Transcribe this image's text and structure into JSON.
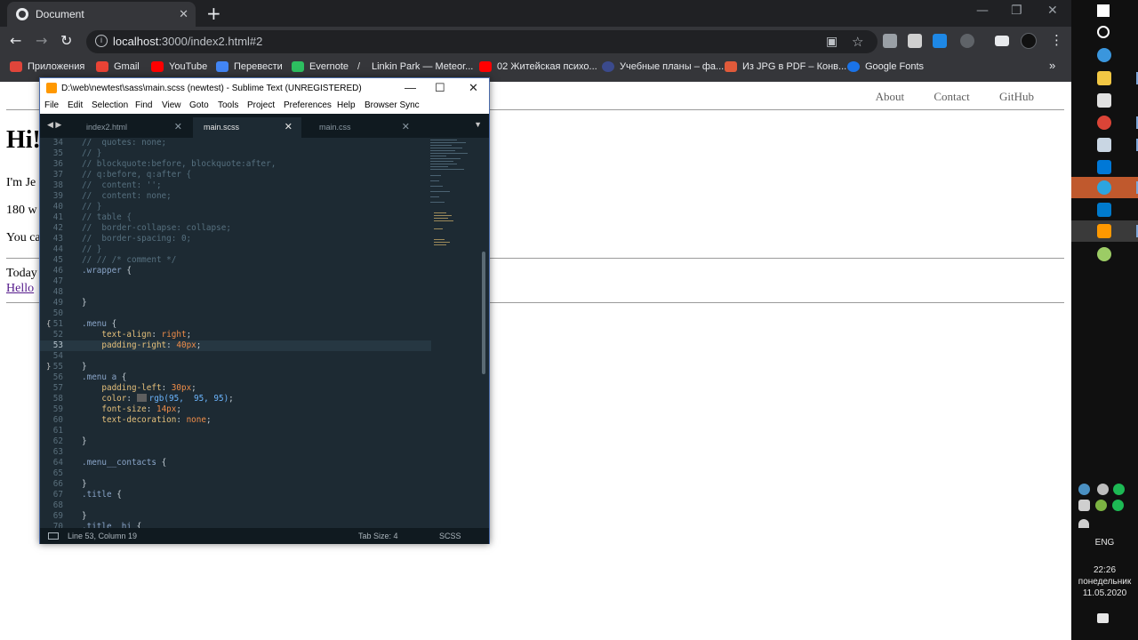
{
  "chrome": {
    "tab_title": "Document",
    "tab_close": "✕",
    "new_tab": "+",
    "window_controls": [
      "—",
      "❐",
      "✕"
    ],
    "url_host": "localhost",
    "url_rest": ":3000/index2.html#2",
    "icons": [
      "back-icon",
      "forward-icon",
      "reload-icon",
      "info-icon",
      "translate-icon",
      "star-icon",
      "menu-dots-icon"
    ],
    "bookmarks": [
      {
        "label": "Приложения",
        "color": "#e0453a"
      },
      {
        "label": "Gmail",
        "color": "#ea4335"
      },
      {
        "label": "YouTube",
        "color": "#ff0000"
      },
      {
        "label": "Перевести",
        "color": "#4285f4"
      },
      {
        "label": "Evernote",
        "color": "#2dbe60"
      },
      {
        "label": "Linkin Park — Meteor...",
        "color": "#dddddd"
      },
      {
        "label": "02 Житейская психо...",
        "color": "#ff0000"
      },
      {
        "label": "Учебные планы – фа...",
        "color": "#3b4a8c"
      },
      {
        "label": "Из JPG в PDF – Конв...",
        "color": "#e05a3a"
      },
      {
        "label": "Google Fonts",
        "color": "#1a73e8"
      }
    ],
    "bookmarks_more": "»"
  },
  "page": {
    "menu": [
      "About",
      "Contact",
      "GitHub"
    ],
    "heading": "Hi!",
    "p1": "I'm Je",
    "p2": "180 w",
    "p3": "You ca",
    "today": "Today",
    "hello_link": "Hello"
  },
  "sublime": {
    "title": "D:\\web\\newtest\\sass\\main.scss (newtest) - Sublime Text (UNREGISTERED)",
    "window_controls": [
      "—",
      "☐",
      "✕"
    ],
    "menu": [
      "File",
      "Edit",
      "Selection",
      "Find",
      "View",
      "Goto",
      "Tools",
      "Project",
      "Preferences",
      "Help",
      "Browser Sync"
    ],
    "tabs": [
      {
        "name": "index2.html",
        "close": "✕",
        "active": false
      },
      {
        "name": "main.scss",
        "close": "✕",
        "active": true
      },
      {
        "name": "main.css",
        "close": "✕",
        "active": false
      }
    ],
    "tab_nav": "◀ ▶",
    "tab_dropdown": "▼",
    "lines": [
      {
        "n": "34",
        "t": "//  quotes: none;"
      },
      {
        "n": "35",
        "t": "// }"
      },
      {
        "n": "36",
        "t": "// blockquote:before, blockquote:after,"
      },
      {
        "n": "37",
        "t": "// q:before, q:after {"
      },
      {
        "n": "38",
        "t": "//  content: '';"
      },
      {
        "n": "39",
        "t": "//  content: none;"
      },
      {
        "n": "40",
        "t": "// }"
      },
      {
        "n": "41",
        "t": "// table {"
      },
      {
        "n": "42",
        "t": "//  border-collapse: collapse;"
      },
      {
        "n": "43",
        "t": "//  border-spacing: 0;"
      },
      {
        "n": "44",
        "t": "// }"
      },
      {
        "n": "45",
        "t": "// // /* comment */"
      },
      {
        "n": "46",
        "t": ".wrapper {"
      },
      {
        "n": "47",
        "t": ""
      },
      {
        "n": "48",
        "t": ""
      },
      {
        "n": "49",
        "t": "}"
      },
      {
        "n": "50",
        "t": ""
      },
      {
        "n": "51",
        "t": ".menu {"
      },
      {
        "n": "52",
        "t": "    text-align: right;"
      },
      {
        "n": "53",
        "t": "    padding-right: 40px;"
      },
      {
        "n": "54",
        "t": ""
      },
      {
        "n": "55",
        "t": "}"
      },
      {
        "n": "56",
        "t": ".menu a {"
      },
      {
        "n": "57",
        "t": "    padding-left: 30px;"
      },
      {
        "n": "58",
        "t": "    color: rgb(95,  95, 95);"
      },
      {
        "n": "59",
        "t": "    font-size: 14px;"
      },
      {
        "n": "60",
        "t": "    text-decoration: none;"
      },
      {
        "n": "61",
        "t": ""
      },
      {
        "n": "62",
        "t": "}"
      },
      {
        "n": "63",
        "t": ""
      },
      {
        "n": "64",
        "t": ".menu__contacts {"
      },
      {
        "n": "65",
        "t": ""
      },
      {
        "n": "66",
        "t": "}"
      },
      {
        "n": "67",
        "t": ".title {"
      },
      {
        "n": "68",
        "t": ""
      },
      {
        "n": "69",
        "t": "}"
      },
      {
        "n": "70",
        "t": ".title__hi {"
      }
    ],
    "current_line": "53",
    "folds": [
      "{",
      "}"
    ],
    "status_position": "Line 53, Column 19",
    "status_tab": "Tab Size: 4",
    "status_syntax": "SCSS"
  },
  "taskbar": {
    "icons": [
      "windows-start-icon",
      "search-icon",
      "edge-icon",
      "file-explorer-icon",
      "store-icon",
      "chrome-icon",
      "photos-icon",
      "mail-icon",
      "telegram-icon",
      "vscode-icon",
      "sublime-icon",
      "paint-icon"
    ],
    "language": "ENG",
    "time": "22:26",
    "weekday": "понедельник",
    "date": "11.05.2020"
  }
}
